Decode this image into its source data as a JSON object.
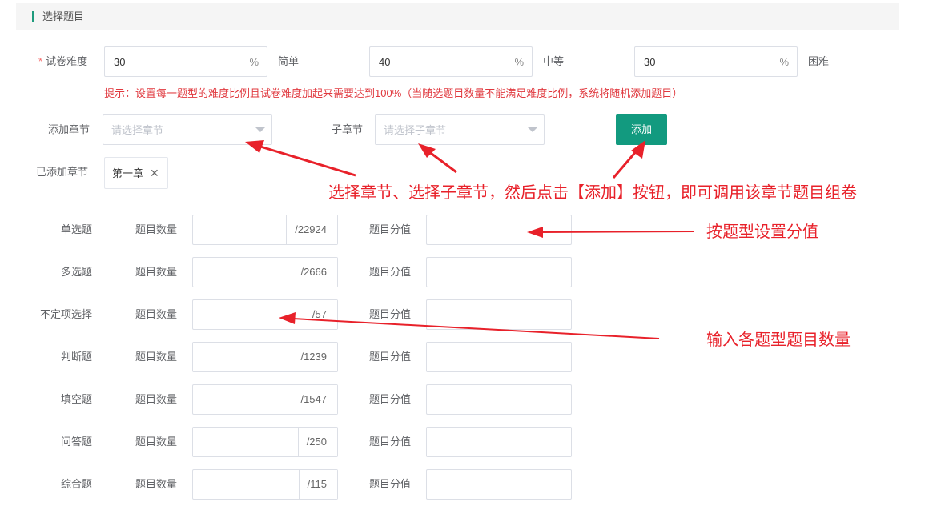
{
  "section": {
    "title": "选择题目"
  },
  "difficulty": {
    "label": "试卷难度",
    "required_mark": "*",
    "fields": [
      {
        "value": "30",
        "suffix": "%",
        "level": "简单"
      },
      {
        "value": "40",
        "suffix": "%",
        "level": "中等"
      },
      {
        "value": "30",
        "suffix": "%",
        "level": "困难"
      }
    ],
    "hint": "提示：设置每一题型的难度比例且试卷难度加起来需要达到100%（当随选题目数量不能满足难度比例，系统将随机添加题目）"
  },
  "chapter": {
    "label": "添加章节",
    "placeholder": "请选择章节",
    "sub_label": "子章节",
    "sub_placeholder": "请选择子章节",
    "add_button": "添加"
  },
  "added": {
    "label": "已添加章节",
    "tags": [
      {
        "text": "第一章",
        "close": "✕"
      }
    ]
  },
  "question_types": [
    {
      "name": "单选题",
      "count_label": "题目数量",
      "total": "/22924",
      "score_label": "题目分值"
    },
    {
      "name": "多选题",
      "count_label": "题目数量",
      "total": "/2666",
      "score_label": "题目分值"
    },
    {
      "name": "不定项选择",
      "count_label": "题目数量",
      "total": "/57",
      "score_label": "题目分值"
    },
    {
      "name": "判断题",
      "count_label": "题目数量",
      "total": "/1239",
      "score_label": "题目分值"
    },
    {
      "name": "填空题",
      "count_label": "题目数量",
      "total": "/1547",
      "score_label": "题目分值"
    },
    {
      "name": "问答题",
      "count_label": "题目数量",
      "total": "/250",
      "score_label": "题目分值"
    },
    {
      "name": "综合题",
      "count_label": "题目数量",
      "total": "/115",
      "score_label": "题目分值"
    }
  ],
  "annotations": {
    "chapter_note": "选择章节、选择子章节，然后点击【添加】按钮，即可调用该章节题目组卷",
    "score_note": "按题型设置分值",
    "count_note": "输入各题型题目数量"
  },
  "colors": {
    "accent": "#129a7f",
    "annotation": "#e8212a",
    "hint": "#e0383e",
    "required": "#f56c6c"
  }
}
